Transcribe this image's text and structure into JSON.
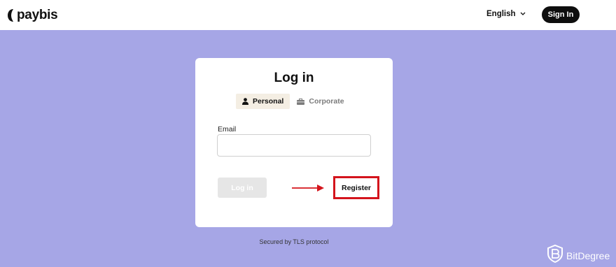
{
  "header": {
    "logo_text": "paybis",
    "language": "English",
    "sign_in": "Sign In"
  },
  "login": {
    "title": "Log in",
    "tabs": [
      {
        "label": "Personal",
        "icon": "person-icon",
        "active": true
      },
      {
        "label": "Corporate",
        "icon": "briefcase-icon",
        "active": false
      }
    ],
    "email_label": "Email",
    "email_value": "",
    "login_button": "Log in",
    "register_button": "Register"
  },
  "footer": {
    "tls_text": "Secured by TLS protocol"
  },
  "watermark": {
    "text": "BitDegree"
  },
  "colors": {
    "background": "#a6a6e6",
    "annotation_red": "#d4141c",
    "active_tab_bg": "#f4eee3"
  }
}
